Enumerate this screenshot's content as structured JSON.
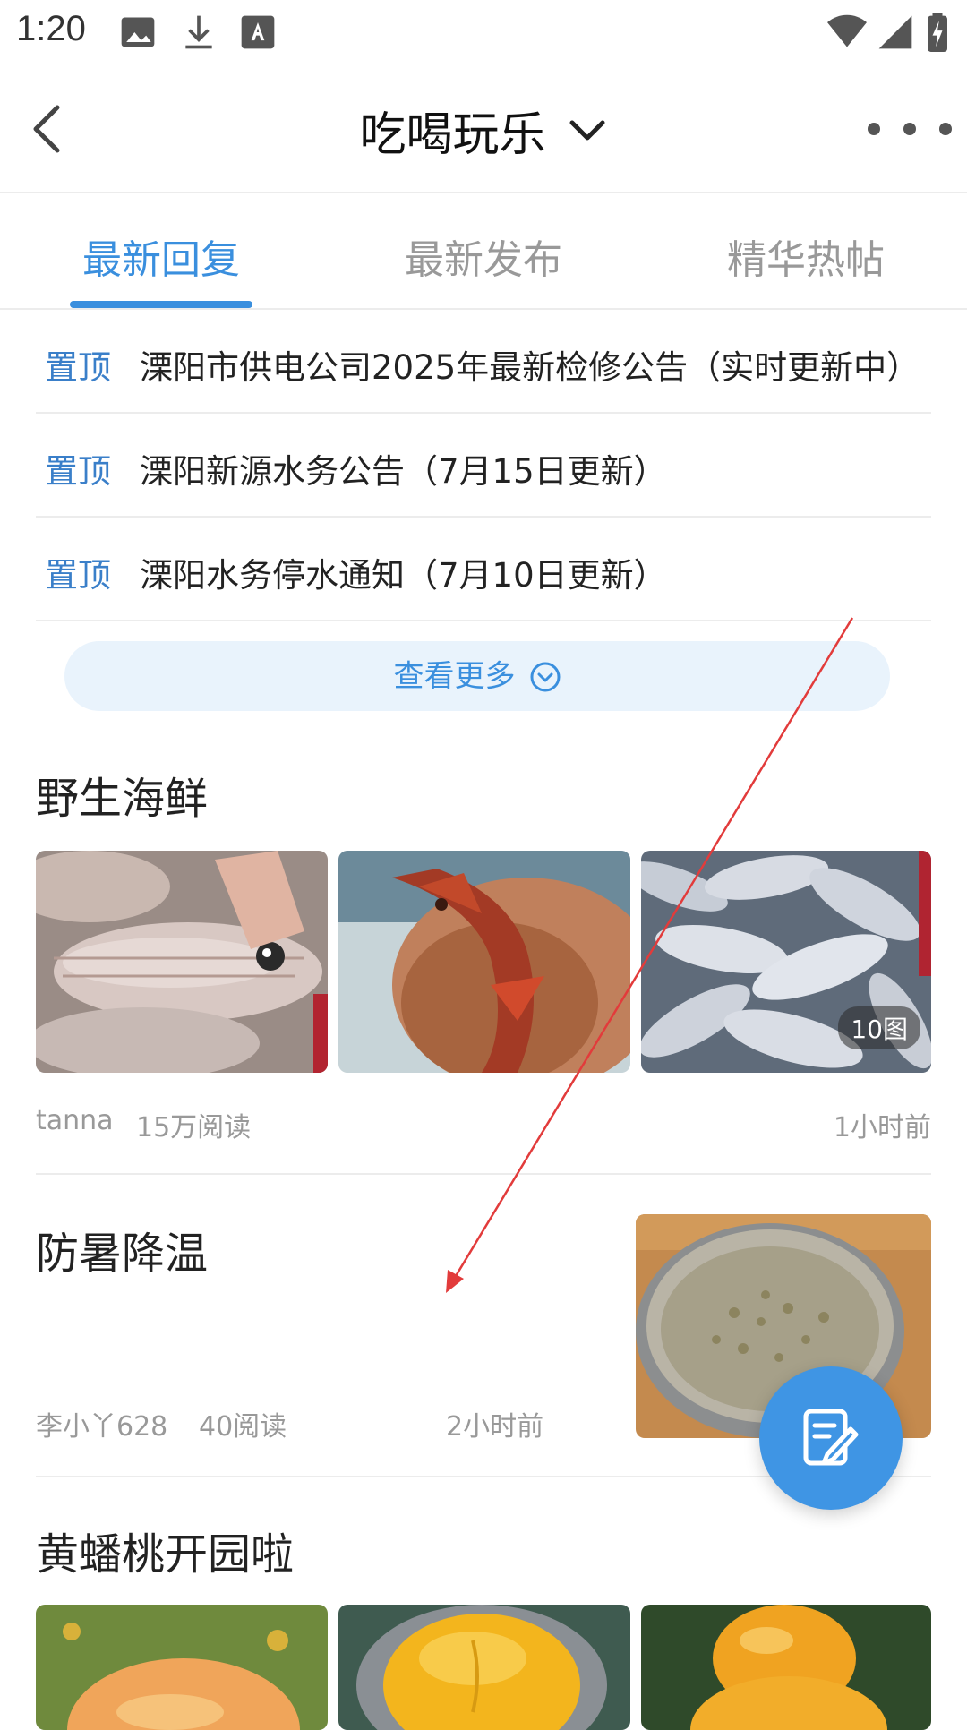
{
  "status_bar": {
    "time": "1:20",
    "icons": [
      "image-icon",
      "download-icon",
      "keyboard-a-icon",
      "wifi-icon",
      "signal-icon",
      "battery-charging-icon"
    ]
  },
  "header": {
    "title": "吃喝玩乐",
    "back_icon": "chevron-left-icon",
    "dropdown_icon": "chevron-down-icon",
    "more_icon": "more-dots-icon"
  },
  "tabs": [
    {
      "label": "最新回复",
      "active": true
    },
    {
      "label": "最新发布",
      "active": false
    },
    {
      "label": "精华热帖",
      "active": false
    }
  ],
  "sticky_posts": [
    {
      "tag": "置顶",
      "text": "溧阳市供电公司2025年最新检修公告（实时更新中）"
    },
    {
      "tag": "置顶",
      "text": "溧阳新源水务公告（7月15日更新）"
    },
    {
      "tag": "置顶",
      "text": "溧阳水务停水通知（7月10日更新）"
    }
  ],
  "see_more": {
    "label": "查看更多"
  },
  "posts": [
    {
      "title": "野生海鲜",
      "author": "tanna",
      "reads": "15万阅读",
      "time": "1小时前",
      "image_count_badge": "10图"
    },
    {
      "title": "防暑降温",
      "author": "李小丫628",
      "reads": "40阅读",
      "time": "2小时前"
    },
    {
      "title": "黄蟠桃开园啦"
    }
  ],
  "colors": {
    "accent": "#3a8fde",
    "fab": "#3f95e4",
    "annotation_arrow": "#e23b3b"
  }
}
